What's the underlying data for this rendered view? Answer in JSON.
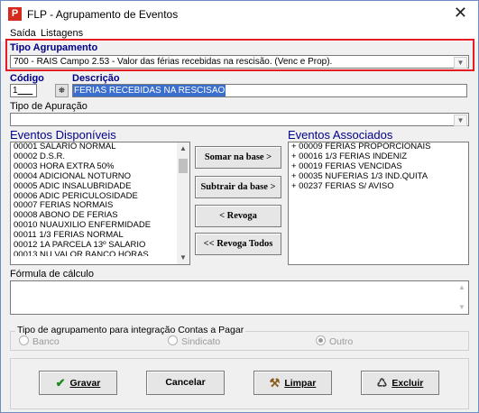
{
  "window": {
    "title": "FLP - Agrupamento de Eventos",
    "app_icon_glyph": "P",
    "close_glyph": "✕"
  },
  "menu": [
    {
      "label": "Saída"
    },
    {
      "label": "Listagens"
    }
  ],
  "tipo_agrupamento": {
    "label": "Tipo Agrupamento",
    "value": "700 - RAIS Campo 2.53 - Valor das férias recebidas na rescisão. (Venc e Prop)."
  },
  "codigo": {
    "label": "Código",
    "value": "1"
  },
  "descricao": {
    "label": "Descrição",
    "value": "FERIAS RECEBIDAS NA RESCISAO"
  },
  "tipo_apuracao": {
    "label": "Tipo de Apuração",
    "value": ""
  },
  "eventos_disponiveis": {
    "label": "Eventos Disponíveis",
    "items": [
      "00001 SALARIO NORMAL",
      "00002 D.S.R.",
      "00003 HORA EXTRA 50%",
      "00004 ADICIONAL NOTURNO",
      "00005 ADIC INSALUBRIDADE",
      "00006 ADIC PERICULOSIDADE",
      "00007 FERIAS NORMAIS",
      "00008 ABONO DE FERIAS",
      "00010 NUAUXILIO ENFERMIDADE",
      "00011 1/3 FERIAS NORMAL",
      "00012 1A PARCELA 13º SALARIO",
      "00013 NU VALOR BANCO HORAS"
    ]
  },
  "eventos_associados": {
    "label": "Eventos Associados",
    "items": [
      "+ 00009 FERIAS PROPORCIONAIS",
      "+ 00016 1/3 FERIAS INDENIZ",
      "+ 00019 FERIAS VENCIDAS",
      "+ 00035 NUFERIAS 1/3 IND.QUITA",
      "+ 00237 FERIAS S/ AVISO"
    ]
  },
  "actions": {
    "somar": "Somar  na base >",
    "subtrair": "Subtrair da base >",
    "revoga": "< Revoga",
    "revoga_todos": "<< Revoga Todos"
  },
  "formula": {
    "label": "Fórmula de cálculo",
    "value": ""
  },
  "integracao": {
    "label": "Tipo de agrupamento para integração Contas a Pagar",
    "options": [
      {
        "label": "Banco",
        "selected": false
      },
      {
        "label": "Sindicato",
        "selected": false
      },
      {
        "label": "Outro",
        "selected": true
      }
    ]
  },
  "footer_buttons": {
    "gravar": "Gravar",
    "cancelar": "Cancelar",
    "limpar": "Limpar",
    "excluir": "Excluir"
  },
  "icons": {
    "binoculars": "binoculars-icon",
    "check": "check-icon",
    "eraser": "broom-icon",
    "delete": "trash-icon"
  },
  "colors": {
    "highlight_border": "#e51c23",
    "label_blue": "#00008b",
    "selection": "#3b6fce",
    "check_green": "#1a8a1a"
  }
}
